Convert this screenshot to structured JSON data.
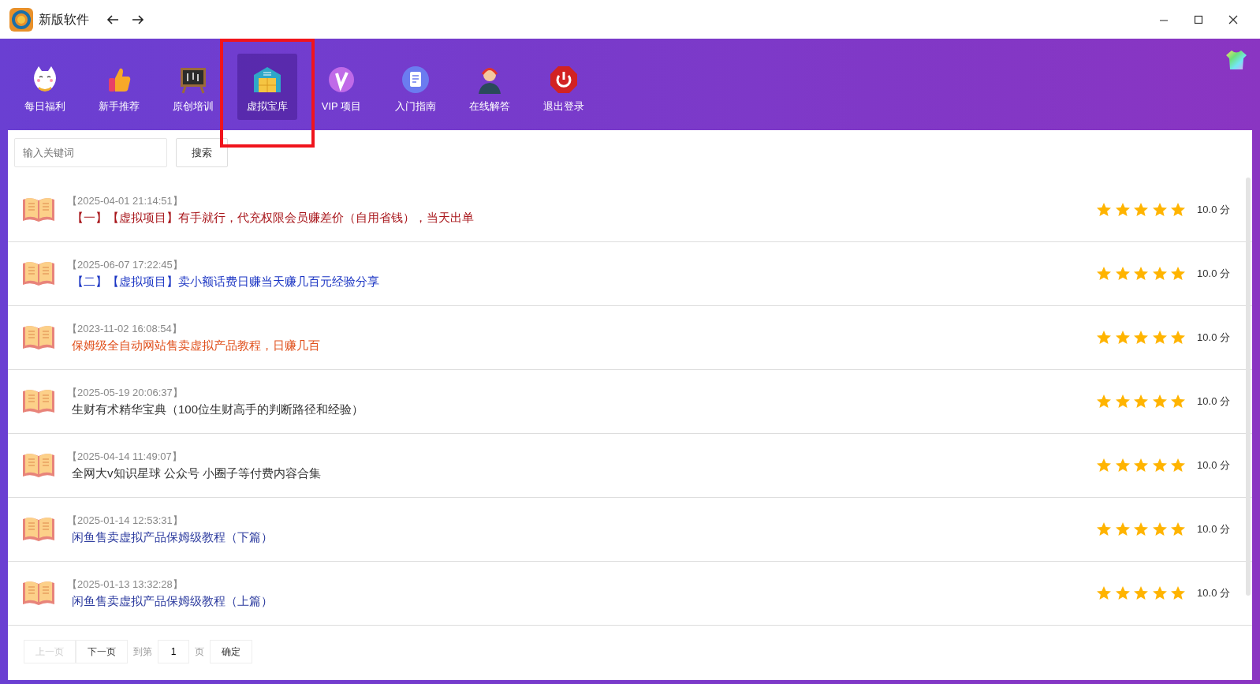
{
  "window": {
    "title": "新版软件"
  },
  "tabs": [
    {
      "label": "每日福利",
      "selected": false,
      "marked": false
    },
    {
      "label": "新手推荐",
      "selected": false,
      "marked": false
    },
    {
      "label": "原创培训",
      "selected": false,
      "marked": false
    },
    {
      "label": "虚拟宝库",
      "selected": true,
      "marked": true
    },
    {
      "label": "VIP 项目",
      "selected": false,
      "marked": false
    },
    {
      "label": "入门指南",
      "selected": false,
      "marked": false
    },
    {
      "label": "在线解答",
      "selected": false,
      "marked": false
    },
    {
      "label": "退出登录",
      "selected": false,
      "marked": false
    }
  ],
  "search": {
    "placeholder": "输入关键词",
    "button": "搜索"
  },
  "items": [
    {
      "date": "【2025-04-01 21:14:51】",
      "title": "【一】【虚拟项目】有手就行，代充权限会员赚差价（自用省钱），当天出单",
      "color": "#a8161b",
      "stars": 5,
      "score": "10.0 分"
    },
    {
      "date": "【2025-06-07 17:22:45】",
      "title": "【二】【虚拟项目】卖小额话费日赚当天赚几百元经验分享",
      "color": "#1c36c4",
      "stars": 5,
      "score": "10.0 分"
    },
    {
      "date": "【2023-11-02 16:08:54】",
      "title": "保姆级全自动网站售卖虚拟产品教程，日赚几百",
      "color": "#e0501c",
      "stars": 5,
      "score": "10.0 分"
    },
    {
      "date": "【2025-05-19 20:06:37】",
      "title": "生财有术精华宝典（100位生财高手的判断路径和经验）",
      "color": "#333333",
      "stars": 5,
      "score": "10.0 分"
    },
    {
      "date": "【2025-04-14 11:49:07】",
      "title": "全网大v知识星球 公众号 小圈子等付费内容合集",
      "color": "#333333",
      "stars": 5,
      "score": "10.0 分"
    },
    {
      "date": "【2025-01-14 12:53:31】",
      "title": "闲鱼售卖虚拟产品保姆级教程（下篇）",
      "color": "#2b3a9e",
      "stars": 5,
      "score": "10.0 分"
    },
    {
      "date": "【2025-01-13 13:32:28】",
      "title": "闲鱼售卖虚拟产品保姆级教程（上篇）",
      "color": "#2b3a9e",
      "stars": 5,
      "score": "10.0 分"
    }
  ],
  "pager": {
    "prev": "上一页",
    "prev_disabled": true,
    "next": "下一页",
    "goto": "到第",
    "page": "1",
    "unit": "页",
    "confirm": "确定"
  }
}
